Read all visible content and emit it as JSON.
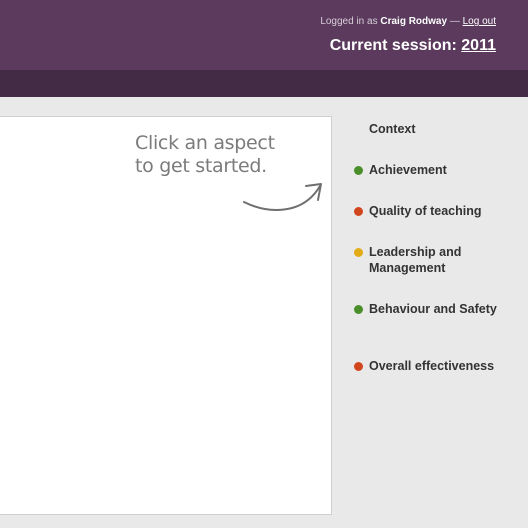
{
  "header": {
    "login_prefix": "Logged in as",
    "user_name": "Craig Rodway",
    "separator": "—",
    "logout_label": "Log out",
    "session_label": "Current session:",
    "session_year": "2011"
  },
  "panel": {
    "hint_line1": "Click an aspect",
    "hint_line2": "to get started."
  },
  "aspects": [
    {
      "label": "Context",
      "status": "none",
      "color": ""
    },
    {
      "label": "Achievement",
      "status": "green",
      "color": "#4a8f2a"
    },
    {
      "label": "Quality of teaching",
      "status": "red",
      "color": "#d2461e"
    },
    {
      "label": "Leadership and Management",
      "status": "amber",
      "color": "#e2ac16"
    },
    {
      "label": "Behaviour and Safety",
      "status": "green",
      "color": "#4a8f2a"
    },
    {
      "label": "Overall effectiveness",
      "status": "red",
      "color": "#d2461e"
    }
  ],
  "colors": {
    "header_bg": "#5b3a5d",
    "header_band": "#432a45",
    "page_bg": "#e9e9e9"
  }
}
